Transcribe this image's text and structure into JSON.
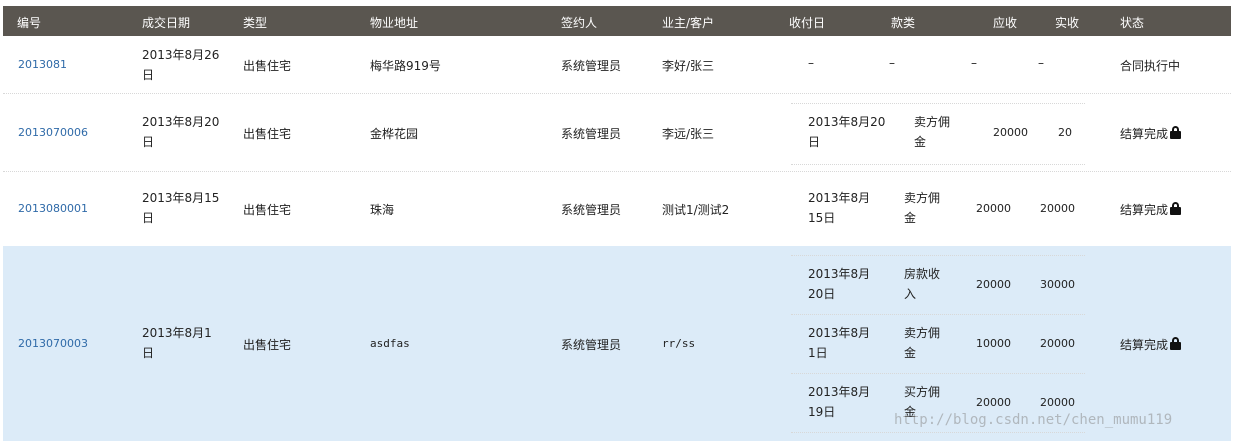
{
  "headers": {
    "id": "编号",
    "date": "成交日期",
    "type": "类型",
    "address": "物业地址",
    "signer": "签约人",
    "owner": "业主/客户",
    "collect_date": "收付日",
    "payment": "款类",
    "receivable": "应收",
    "received": "实收",
    "status": "状态"
  },
  "rows": [
    {
      "id": "2013081",
      "date": "2013年8月26日",
      "type": "出售住宅",
      "address": "梅华路919号",
      "signer": "系统管理员",
      "owner": "李好/张三",
      "payments": [
        {
          "date": "–",
          "kind": "–",
          "receivable": "–",
          "received": "–"
        }
      ],
      "status": "合同执行中",
      "locked": false
    },
    {
      "id": "2013070006",
      "date": "2013年8月20日",
      "type": "出售住宅",
      "address": "金桦花园",
      "signer": "系统管理员",
      "owner": "李远/张三",
      "payments": [
        {
          "date": "2013年8月20日",
          "kind": "卖方佣金",
          "receivable": "20000",
          "received": "20"
        }
      ],
      "status": "结算完成",
      "locked": true
    },
    {
      "id": "2013080001",
      "date": "2013年8月15日",
      "type": "出售住宅",
      "address": "珠海",
      "signer": "系统管理员",
      "owner": "测试1/测试2",
      "payments": [
        {
          "date": "2013年8月15日",
          "kind": "卖方佣金",
          "receivable": "20000",
          "received": "20000"
        }
      ],
      "status": "结算完成",
      "locked": true
    },
    {
      "id": "2013070003",
      "date": "2013年8月1日",
      "type": "出售住宅",
      "address": "asdfas",
      "signer": "系统管理员",
      "owner": "rr/ss",
      "payments": [
        {
          "date": "2013年8月20日",
          "kind": "房款收入",
          "receivable": "20000",
          "received": "30000"
        },
        {
          "date": "2013年8月1日",
          "kind": "卖方佣金",
          "receivable": "10000",
          "received": "20000"
        },
        {
          "date": "2013年8月19日",
          "kind": "买方佣金",
          "receivable": "20000",
          "received": "20000"
        }
      ],
      "status": "结算完成",
      "locked": true
    }
  ],
  "watermark": "http://blog.csdn.net/chen_mumu119",
  "icons": {
    "lock": "lock-icon"
  },
  "colors": {
    "header_bg": "#5a5650",
    "link": "#2f6aa8",
    "highlight_row": "#dcebf8"
  }
}
